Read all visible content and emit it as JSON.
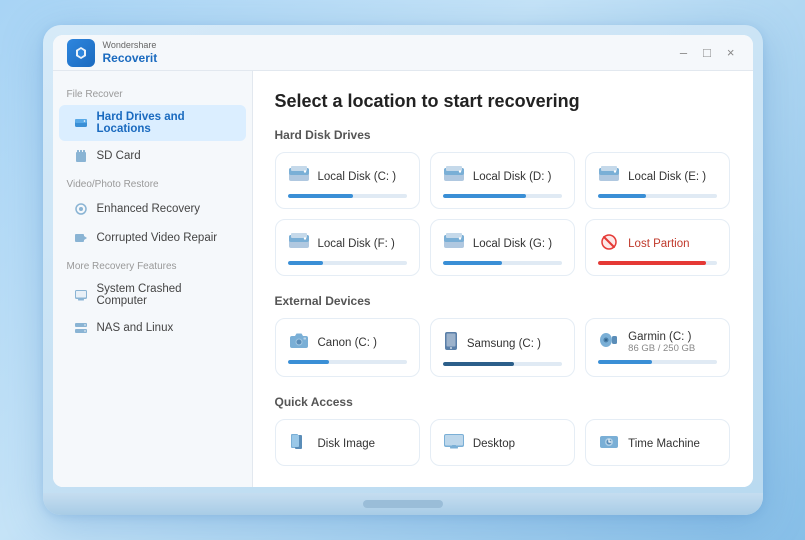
{
  "app": {
    "brand": "Wondershare",
    "product": "Recoverit",
    "title_bar": {
      "minimize": "–",
      "maximize": "□",
      "close": "×"
    }
  },
  "sidebar": {
    "sections": [
      {
        "label": "File Recover",
        "items": [
          {
            "id": "hard-drives",
            "label": "Hard Drives and Locations",
            "active": true
          },
          {
            "id": "sd-card",
            "label": "SD Card",
            "active": false
          }
        ]
      },
      {
        "label": "Video/Photo Restore",
        "items": [
          {
            "id": "enhanced-recovery",
            "label": "Enhanced Recovery",
            "active": false
          },
          {
            "id": "corrupted-video",
            "label": "Corrupted Video Repair",
            "active": false
          }
        ]
      },
      {
        "label": "More Recovery Features",
        "items": [
          {
            "id": "system-crashed",
            "label": "System Crashed Computer",
            "active": false
          },
          {
            "id": "nas-linux",
            "label": "NAS and Linux",
            "active": false
          }
        ]
      }
    ]
  },
  "main": {
    "title": "Select a location to start recovering",
    "sections": [
      {
        "id": "hard-disk-drives",
        "title": "Hard Disk Drives",
        "items": [
          {
            "label": "Local Disk (C: )",
            "fill": 55,
            "type": "hdd",
            "sublabel": ""
          },
          {
            "label": "Local Disk (D: )",
            "fill": 70,
            "type": "hdd",
            "sublabel": ""
          },
          {
            "label": "Local Disk (E: )",
            "fill": 40,
            "type": "hdd",
            "sublabel": ""
          },
          {
            "label": "Local Disk (F: )",
            "fill": 30,
            "type": "hdd",
            "sublabel": ""
          },
          {
            "label": "Local Disk (G: )",
            "fill": 50,
            "type": "hdd",
            "sublabel": ""
          },
          {
            "label": "Lost Partion",
            "fill": 90,
            "type": "lost",
            "sublabel": ""
          }
        ]
      },
      {
        "id": "external-devices",
        "title": "External Devices",
        "items": [
          {
            "label": "Canon (C: )",
            "fill": 35,
            "type": "camera",
            "sublabel": ""
          },
          {
            "label": "Samsung (C: )",
            "fill": 60,
            "type": "phone",
            "sublabel": ""
          },
          {
            "label": "Garmin (C: )",
            "fill": 45,
            "type": "speaker",
            "sublabel": "86 GB / 250 GB"
          }
        ]
      },
      {
        "id": "quick-access",
        "title": "Quick Access",
        "items": [
          {
            "label": "Disk Image",
            "fill": 0,
            "type": "disk-image",
            "sublabel": ""
          },
          {
            "label": "Desktop",
            "fill": 0,
            "type": "desktop",
            "sublabel": ""
          },
          {
            "label": "Time Machine",
            "fill": 0,
            "type": "time-machine",
            "sublabel": ""
          }
        ]
      }
    ]
  }
}
